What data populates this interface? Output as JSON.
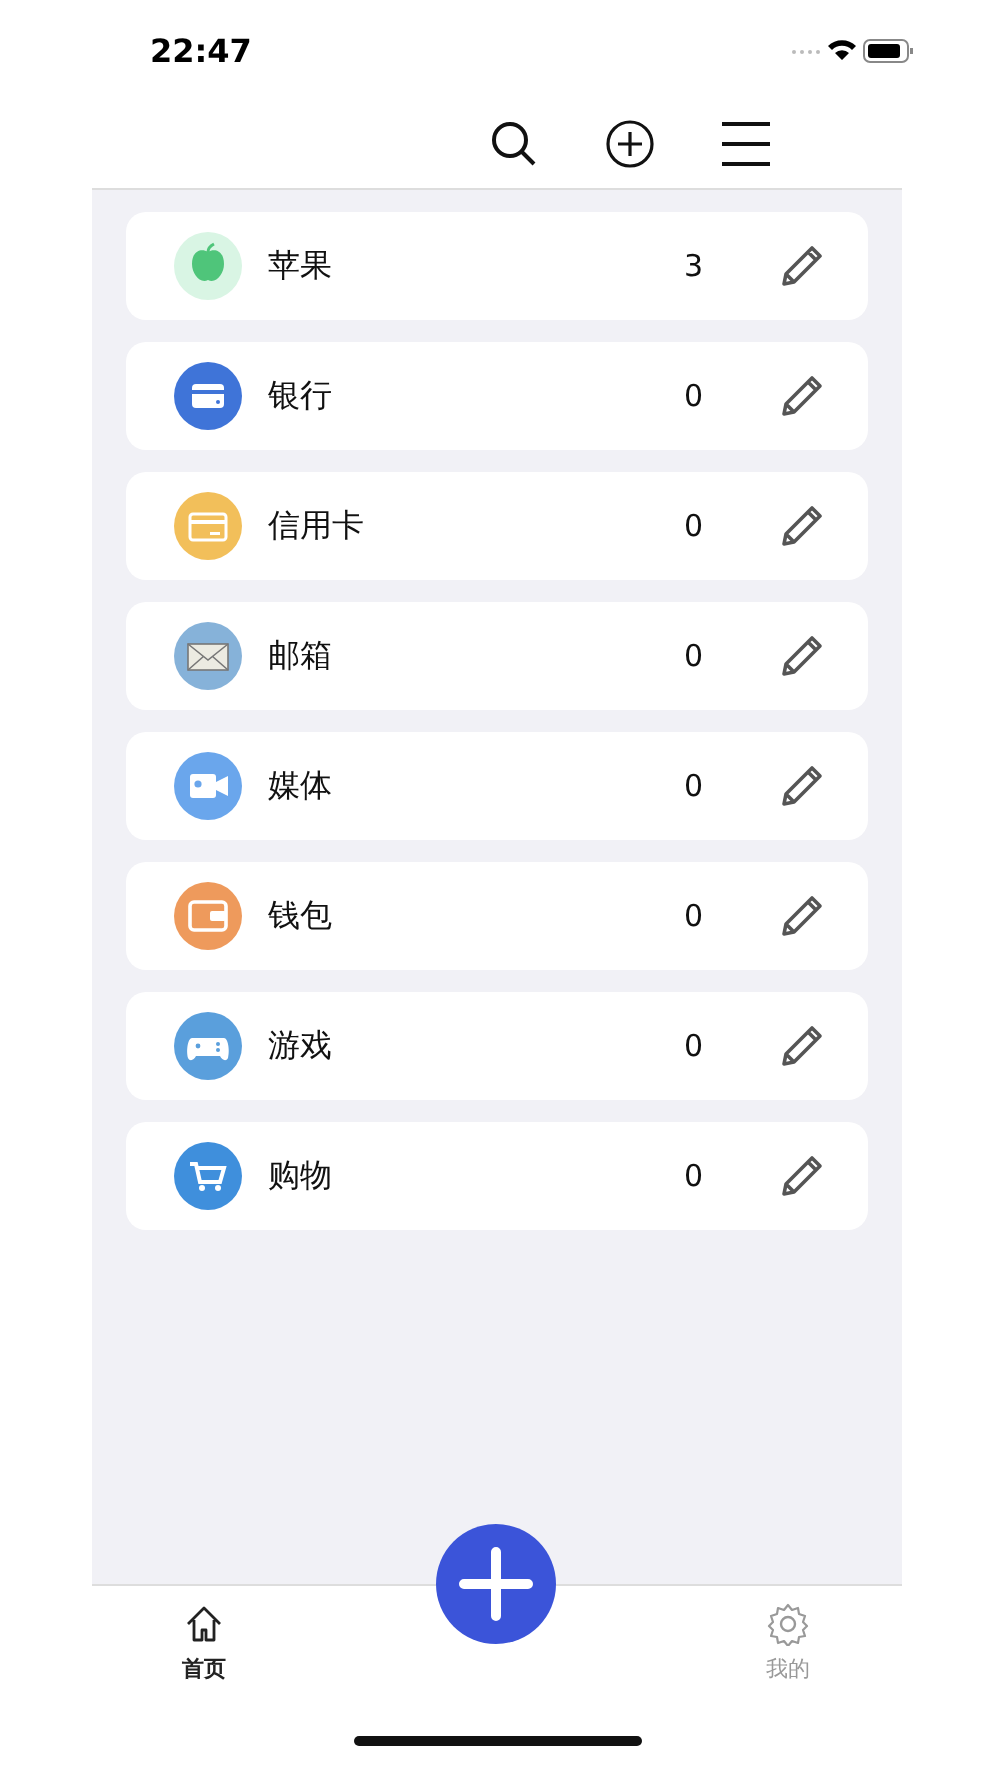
{
  "status_bar": {
    "time": "22:47"
  },
  "categories": [
    {
      "name": "苹果",
      "count": "3",
      "kind": "apple",
      "color": "#d9f5e4"
    },
    {
      "name": "银行",
      "count": "0",
      "kind": "bank",
      "color": "#3f74d8"
    },
    {
      "name": "信用卡",
      "count": "0",
      "kind": "credit-card",
      "color": "#f2bf5a"
    },
    {
      "name": "邮箱",
      "count": "0",
      "kind": "mail",
      "color": "#86b2d9"
    },
    {
      "name": "媒体",
      "count": "0",
      "kind": "video",
      "color": "#6aa6ec"
    },
    {
      "name": "钱包",
      "count": "0",
      "kind": "wallet",
      "color": "#ee9a5c"
    },
    {
      "name": "游戏",
      "count": "0",
      "kind": "gamepad",
      "color": "#5a9fdc"
    },
    {
      "name": "购物",
      "count": "0",
      "kind": "cart",
      "color": "#3f8fdc"
    }
  ],
  "tabs": [
    {
      "label": "首页",
      "kind": "home",
      "selected": true
    },
    {
      "label": "我的",
      "kind": "settings",
      "selected": false
    }
  ]
}
